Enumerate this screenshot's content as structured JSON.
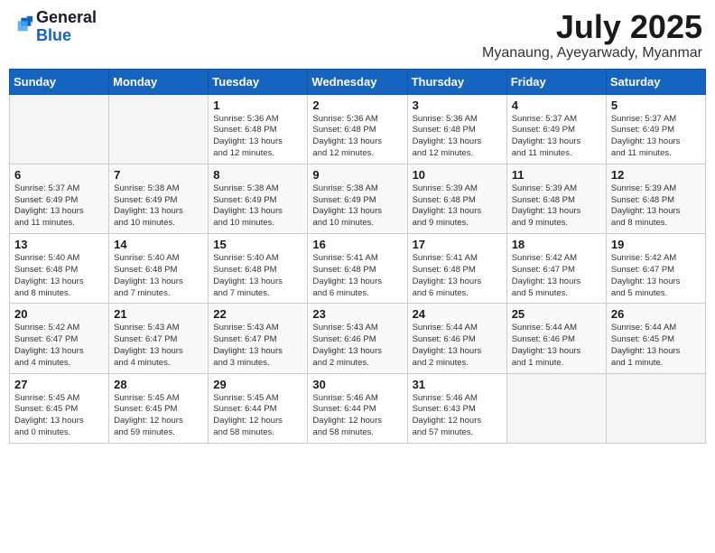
{
  "logo": {
    "general": "General",
    "blue": "Blue"
  },
  "header": {
    "month_year": "July 2025",
    "location": "Myanaung, Ayeyarwady, Myanmar"
  },
  "weekdays": [
    "Sunday",
    "Monday",
    "Tuesday",
    "Wednesday",
    "Thursday",
    "Friday",
    "Saturday"
  ],
  "weeks": [
    [
      {
        "day": "",
        "info": ""
      },
      {
        "day": "",
        "info": ""
      },
      {
        "day": "1",
        "info": "Sunrise: 5:36 AM\nSunset: 6:48 PM\nDaylight: 13 hours\nand 12 minutes."
      },
      {
        "day": "2",
        "info": "Sunrise: 5:36 AM\nSunset: 6:48 PM\nDaylight: 13 hours\nand 12 minutes."
      },
      {
        "day": "3",
        "info": "Sunrise: 5:36 AM\nSunset: 6:48 PM\nDaylight: 13 hours\nand 12 minutes."
      },
      {
        "day": "4",
        "info": "Sunrise: 5:37 AM\nSunset: 6:49 PM\nDaylight: 13 hours\nand 11 minutes."
      },
      {
        "day": "5",
        "info": "Sunrise: 5:37 AM\nSunset: 6:49 PM\nDaylight: 13 hours\nand 11 minutes."
      }
    ],
    [
      {
        "day": "6",
        "info": "Sunrise: 5:37 AM\nSunset: 6:49 PM\nDaylight: 13 hours\nand 11 minutes."
      },
      {
        "day": "7",
        "info": "Sunrise: 5:38 AM\nSunset: 6:49 PM\nDaylight: 13 hours\nand 10 minutes."
      },
      {
        "day": "8",
        "info": "Sunrise: 5:38 AM\nSunset: 6:49 PM\nDaylight: 13 hours\nand 10 minutes."
      },
      {
        "day": "9",
        "info": "Sunrise: 5:38 AM\nSunset: 6:49 PM\nDaylight: 13 hours\nand 10 minutes."
      },
      {
        "day": "10",
        "info": "Sunrise: 5:39 AM\nSunset: 6:48 PM\nDaylight: 13 hours\nand 9 minutes."
      },
      {
        "day": "11",
        "info": "Sunrise: 5:39 AM\nSunset: 6:48 PM\nDaylight: 13 hours\nand 9 minutes."
      },
      {
        "day": "12",
        "info": "Sunrise: 5:39 AM\nSunset: 6:48 PM\nDaylight: 13 hours\nand 8 minutes."
      }
    ],
    [
      {
        "day": "13",
        "info": "Sunrise: 5:40 AM\nSunset: 6:48 PM\nDaylight: 13 hours\nand 8 minutes."
      },
      {
        "day": "14",
        "info": "Sunrise: 5:40 AM\nSunset: 6:48 PM\nDaylight: 13 hours\nand 7 minutes."
      },
      {
        "day": "15",
        "info": "Sunrise: 5:40 AM\nSunset: 6:48 PM\nDaylight: 13 hours\nand 7 minutes."
      },
      {
        "day": "16",
        "info": "Sunrise: 5:41 AM\nSunset: 6:48 PM\nDaylight: 13 hours\nand 6 minutes."
      },
      {
        "day": "17",
        "info": "Sunrise: 5:41 AM\nSunset: 6:48 PM\nDaylight: 13 hours\nand 6 minutes."
      },
      {
        "day": "18",
        "info": "Sunrise: 5:42 AM\nSunset: 6:47 PM\nDaylight: 13 hours\nand 5 minutes."
      },
      {
        "day": "19",
        "info": "Sunrise: 5:42 AM\nSunset: 6:47 PM\nDaylight: 13 hours\nand 5 minutes."
      }
    ],
    [
      {
        "day": "20",
        "info": "Sunrise: 5:42 AM\nSunset: 6:47 PM\nDaylight: 13 hours\nand 4 minutes."
      },
      {
        "day": "21",
        "info": "Sunrise: 5:43 AM\nSunset: 6:47 PM\nDaylight: 13 hours\nand 4 minutes."
      },
      {
        "day": "22",
        "info": "Sunrise: 5:43 AM\nSunset: 6:47 PM\nDaylight: 13 hours\nand 3 minutes."
      },
      {
        "day": "23",
        "info": "Sunrise: 5:43 AM\nSunset: 6:46 PM\nDaylight: 13 hours\nand 2 minutes."
      },
      {
        "day": "24",
        "info": "Sunrise: 5:44 AM\nSunset: 6:46 PM\nDaylight: 13 hours\nand 2 minutes."
      },
      {
        "day": "25",
        "info": "Sunrise: 5:44 AM\nSunset: 6:46 PM\nDaylight: 13 hours\nand 1 minute."
      },
      {
        "day": "26",
        "info": "Sunrise: 5:44 AM\nSunset: 6:45 PM\nDaylight: 13 hours\nand 1 minute."
      }
    ],
    [
      {
        "day": "27",
        "info": "Sunrise: 5:45 AM\nSunset: 6:45 PM\nDaylight: 13 hours\nand 0 minutes."
      },
      {
        "day": "28",
        "info": "Sunrise: 5:45 AM\nSunset: 6:45 PM\nDaylight: 12 hours\nand 59 minutes."
      },
      {
        "day": "29",
        "info": "Sunrise: 5:45 AM\nSunset: 6:44 PM\nDaylight: 12 hours\nand 58 minutes."
      },
      {
        "day": "30",
        "info": "Sunrise: 5:46 AM\nSunset: 6:44 PM\nDaylight: 12 hours\nand 58 minutes."
      },
      {
        "day": "31",
        "info": "Sunrise: 5:46 AM\nSunset: 6:43 PM\nDaylight: 12 hours\nand 57 minutes."
      },
      {
        "day": "",
        "info": ""
      },
      {
        "day": "",
        "info": ""
      }
    ]
  ]
}
